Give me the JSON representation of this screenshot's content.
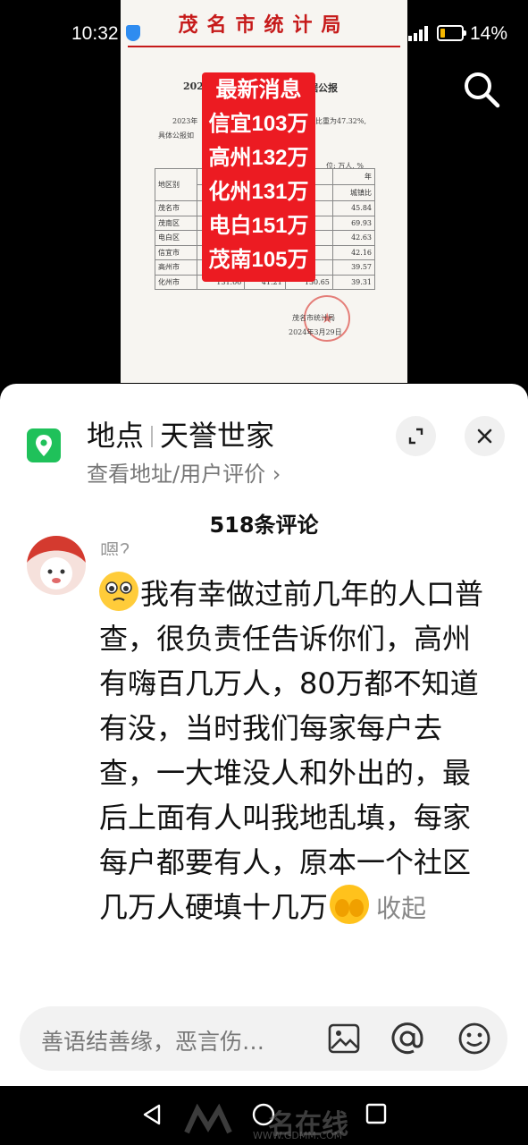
{
  "status_bar": {
    "time": "10:32",
    "battery": "14%"
  },
  "document": {
    "header": "茂名市统计局",
    "title_left": "2023",
    "title_right": "据公报",
    "para_line1_left": "2023年",
    "para_line1_right": "比重为47.32%,",
    "para_line2": "具体公报如",
    "unit": "位: 万人, %",
    "col_region": "地区别",
    "col_year": "年",
    "col_urban": "城镇比",
    "rows": [
      {
        "name": "茂名市",
        "v1": "",
        "v2": "",
        "v3": "",
        "v4": "45.84"
      },
      {
        "name": "茂南区",
        "v1": "",
        "v2": "",
        "v3": "",
        "v4": "69.93"
      },
      {
        "name": "电白区",
        "v1": "",
        "v2": "",
        "v3": "",
        "v4": "42.63"
      },
      {
        "name": "信宜市",
        "v1": "",
        "v2": "",
        "v3": "",
        "v4": "42.16"
      },
      {
        "name": "高州市",
        "v1": "",
        "v2": "",
        "v3": "",
        "v4": "39.57"
      },
      {
        "name": "化州市",
        "v1": "131.06",
        "v2": "41.21",
        "v3": "130.65",
        "v4": "39.31"
      }
    ],
    "sign_org": "茂名市统计局",
    "sign_date": "2024年3月29日",
    "overlay_lines": [
      "最新消息",
      "信宜103万",
      "高州132万",
      "化州131万",
      "电白151万",
      "茂南105万"
    ]
  },
  "location": {
    "label": "地点",
    "name": "天誉世家",
    "sub": "查看地址/用户评价"
  },
  "comments": {
    "count_label": "518条评论",
    "previous_text": "嗯？",
    "text": "我有幸做过前几年的人口普查，很负责任告诉你们，高州有嗨百几万人，80万都不知道有没，当时我们每家每户去查，一大堆没人和外出的，最后上面有人叫我地乱填，每家每户都要有人，原本一个社区几万人硬填十几万",
    "collapse": "收起"
  },
  "input": {
    "placeholder": "善语结善缘，恶言伤…"
  },
  "watermark": {
    "brand": "名在线",
    "url": "WWW.GDMM.COM"
  },
  "colors": {
    "accent_red": "#ec1b22",
    "location_green": "#1fc15a"
  }
}
